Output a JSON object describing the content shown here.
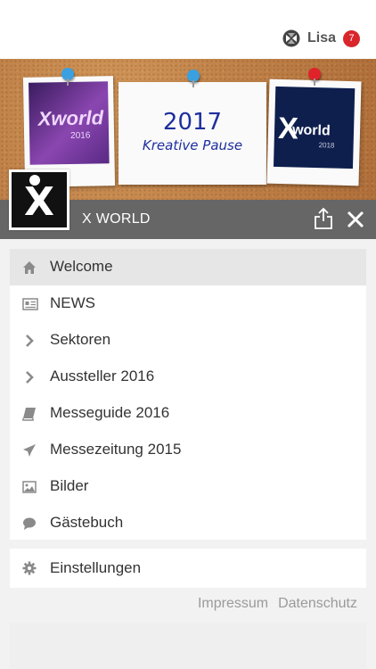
{
  "user": {
    "name": "Lisa",
    "notifications": "7"
  },
  "banner": {
    "left_photo_text": "Xworld",
    "left_photo_year": "2016",
    "note_line1": "2017",
    "note_line2": "Kreative Pause",
    "right_photo_text": "world",
    "right_photo_year": "2018"
  },
  "app": {
    "title": "X WORLD"
  },
  "menu": {
    "items": [
      {
        "label": "Welcome",
        "icon": "home-icon"
      },
      {
        "label": "NEWS",
        "icon": "newspaper-icon"
      },
      {
        "label": "Sektoren",
        "icon": "chevron-right-icon"
      },
      {
        "label": "Aussteller 2016",
        "icon": "chevron-right-icon"
      },
      {
        "label": "Messeguide 2016",
        "icon": "book-icon"
      },
      {
        "label": "Messezeitung 2015",
        "icon": "paper-plane-icon"
      },
      {
        "label": "Bilder",
        "icon": "image-icon"
      },
      {
        "label": "Gästebuch",
        "icon": "chat-bubble-icon"
      }
    ],
    "settings": {
      "label": "Einstellungen",
      "icon": "gear-icon"
    }
  },
  "footer": {
    "impressum": "Impressum",
    "datenschutz": "Datenschutz"
  },
  "colors": {
    "badge": "#d8262b",
    "strip": "#5a5a5a",
    "active_row": "#e6e6e6",
    "icon": "#8a8a8a"
  }
}
